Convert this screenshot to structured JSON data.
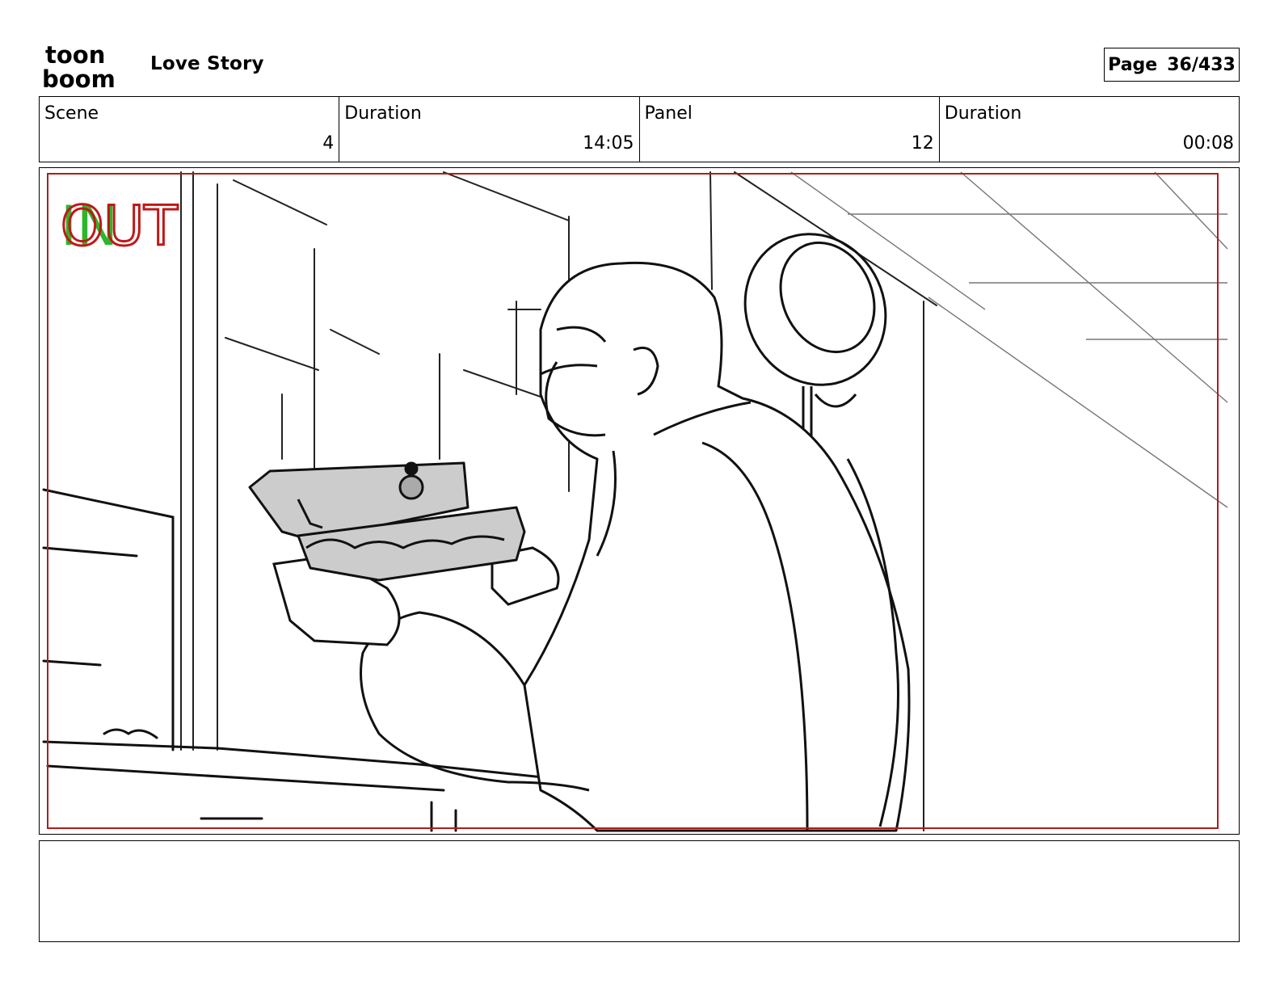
{
  "header": {
    "logo_text_top": "toon",
    "logo_text_bottom": "boom",
    "project_title": "Love Story",
    "page_label": "Page",
    "page_number": "36/433"
  },
  "info": {
    "scene_label": "Scene",
    "scene_value": "4",
    "scene_duration_label": "Duration",
    "scene_duration_value": "14:05",
    "panel_label": "Panel",
    "panel_value": "12",
    "panel_duration_label": "Duration",
    "panel_duration_value": "00:08"
  },
  "panel": {
    "in_marker": "IN",
    "out_marker": "OUT",
    "in_color": "#2db52d",
    "out_color": "#c01818",
    "frame_color": "#b01c1c"
  },
  "notes": {
    "text": ""
  }
}
